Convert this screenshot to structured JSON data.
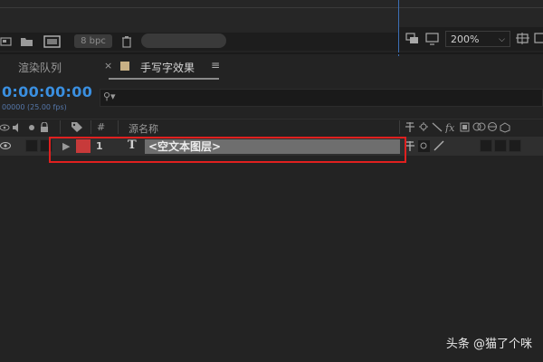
{
  "project_bar": {
    "bit_depth": "8 bpc"
  },
  "viewer": {
    "zoom_level": "200%"
  },
  "tabs": {
    "render_queue": "渲染队列",
    "composition": "手写字效果",
    "close_glyph": "×",
    "menu_glyph": "≡"
  },
  "timeline": {
    "timecode": "0:00:00:00",
    "frame_info": "00000 (25.00 fps)",
    "columns": {
      "number": "#",
      "source_name": "源名称"
    },
    "layers": [
      {
        "index": "1",
        "type_glyph": "T",
        "name": "<空文本图层>"
      }
    ]
  },
  "watermark": "头条 @猫了个咪",
  "colors": {
    "timecode": "#3a8fe0",
    "label_red": "#c73a3a",
    "highlight_box": "#e0201f",
    "viewer_accent": "#3c6fb6"
  }
}
